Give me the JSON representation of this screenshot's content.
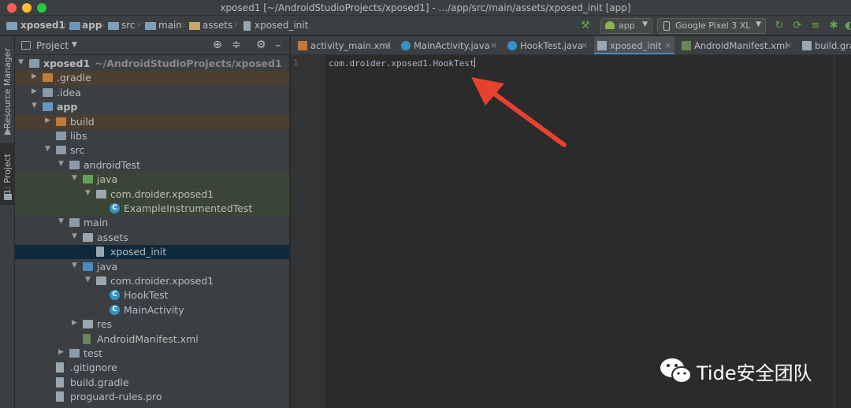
{
  "window": {
    "title": "xposed1 [~/AndroidStudioProjects/xposed1] - .../app/src/main/assets/xposed_init [app]",
    "traffic_colors": [
      "#ff5f57",
      "#febc2e",
      "#28c840"
    ]
  },
  "breadcrumbs": [
    "xposed1",
    "app",
    "src",
    "main",
    "assets",
    "xposed_init"
  ],
  "toolbar": {
    "run_config": "app",
    "device": "Google Pixel 3 XL"
  },
  "side_tabs": {
    "resource_manager": "Resource Manager",
    "project": "1: Project"
  },
  "project_panel": {
    "title": "Project"
  },
  "tree": [
    {
      "label": "xposed1",
      "path": "~/AndroidStudioProjects/xposed1",
      "bold": true,
      "arrow": "down",
      "icon": "folder"
    },
    {
      "label": ".gradle",
      "arrow": "right",
      "icon": "folder-orange",
      "highlight": "excluded"
    },
    {
      "label": ".idea",
      "arrow": "right",
      "icon": "folder"
    },
    {
      "label": "app",
      "bold": true,
      "arrow": "down",
      "icon": "folder-module"
    },
    {
      "label": "build",
      "arrow": "right",
      "icon": "folder-orange",
      "highlight": "excluded"
    },
    {
      "label": "libs",
      "arrow": "",
      "icon": "folder"
    },
    {
      "label": "src",
      "arrow": "down",
      "icon": "folder"
    },
    {
      "label": "androidTest",
      "arrow": "down",
      "icon": "folder"
    },
    {
      "label": "java",
      "arrow": "down",
      "icon": "folder-green",
      "highlight": "test"
    },
    {
      "label": "com.droider.xposed1",
      "arrow": "down",
      "icon": "package",
      "highlight": "test"
    },
    {
      "label": "ExampleInstrumentedTest",
      "arrow": "",
      "icon": "class",
      "highlight": "test"
    },
    {
      "label": "main",
      "arrow": "down",
      "icon": "folder"
    },
    {
      "label": "assets",
      "arrow": "down",
      "icon": "folder-assets"
    },
    {
      "label": "xposed_init",
      "arrow": "",
      "icon": "file",
      "highlight": "selected"
    },
    {
      "label": "java",
      "arrow": "down",
      "icon": "folder-blue"
    },
    {
      "label": "com.droider.xposed1",
      "arrow": "down",
      "icon": "package"
    },
    {
      "label": "HookTest",
      "arrow": "",
      "icon": "class"
    },
    {
      "label": "MainActivity",
      "arrow": "",
      "icon": "class"
    },
    {
      "label": "res",
      "arrow": "right",
      "icon": "folder-res"
    },
    {
      "label": "AndroidManifest.xml",
      "arrow": "",
      "icon": "manifest"
    },
    {
      "label": "test",
      "arrow": "right",
      "icon": "folder"
    },
    {
      "label": ".gitignore",
      "arrow": "",
      "icon": "gitignore"
    },
    {
      "label": "build.gradle",
      "arrow": "",
      "icon": "gradle"
    },
    {
      "label": "proguard-rules.pro",
      "arrow": "",
      "icon": "file"
    }
  ],
  "tabs": [
    {
      "label": "activity_main.xml",
      "icon": "xml"
    },
    {
      "label": "MainActivity.java",
      "icon": "class"
    },
    {
      "label": "HookTest.java",
      "icon": "class"
    },
    {
      "label": "xposed_init",
      "icon": "file",
      "active": true
    },
    {
      "label": "AndroidManifest.xml",
      "icon": "manifest"
    },
    {
      "label": "build.gra",
      "icon": "gradle"
    }
  ],
  "editor": {
    "line_numbers": [
      "1"
    ],
    "lines": [
      "com.droider.xposed1.HookTest"
    ]
  },
  "annotation": {
    "arrow_color": "#e8412f"
  },
  "watermark": {
    "text": "Tide安全团队"
  },
  "colors": {
    "panel": "#3c3f41",
    "editor": "#2b2b2b",
    "selected_row": "#0d293e",
    "excluded_row": "#4b3f32",
    "test_row": "#3a4536",
    "accent": "#4a88c7"
  }
}
